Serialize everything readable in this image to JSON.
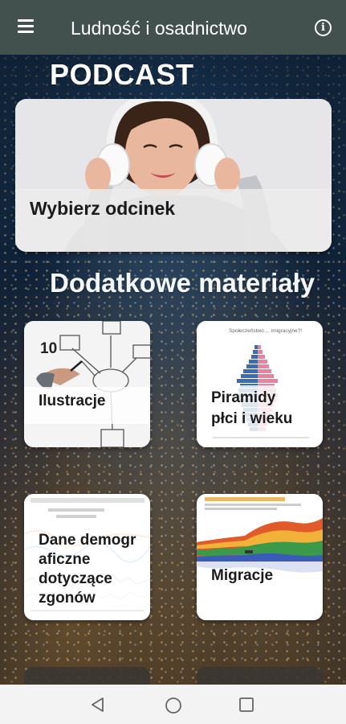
{
  "app": {
    "title": "Ludność i osadnictwo"
  },
  "icons": {
    "menu": "hamburger-menu-icon",
    "info": "info-icon"
  },
  "podcast": {
    "section_title": "PODCAST",
    "card_label": "Wybierz odcinek"
  },
  "materials": {
    "section_title": "Dodatkowe materiały",
    "tiles": [
      {
        "label": "Ilustracje"
      },
      {
        "label_line1": "Piramidy",
        "label_line2": "płci i wieku"
      },
      {
        "label_line1": "Dane demogr",
        "label_line2": "aficzne",
        "label_line3": "dotyczące",
        "label_line4": "zgonów"
      },
      {
        "label": "Migracje"
      }
    ]
  },
  "colors": {
    "appbar": "#42504e",
    "navbar": "#f3f3f3"
  }
}
